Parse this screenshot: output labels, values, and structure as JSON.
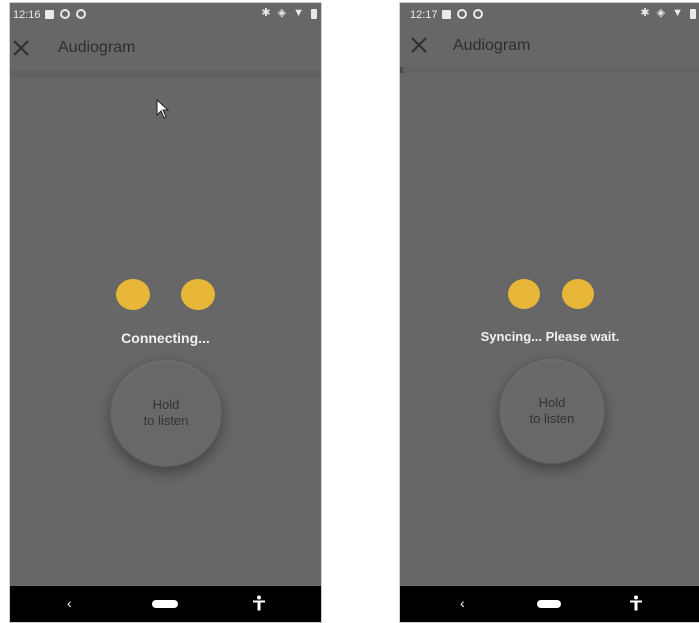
{
  "left": {
    "time": "12:16",
    "app_title": "Audiogram",
    "status_text": "Connecting...",
    "hold_button": {
      "line1": "Hold",
      "line2": "to listen"
    },
    "progress": 0
  },
  "right": {
    "time": "12:17",
    "app_title": "Audiogram",
    "status_text": "Syncing... Please wait.",
    "hold_button": {
      "line1": "Hold",
      "line2": "to listen"
    },
    "progress": 0.01
  },
  "nav": {
    "back": "‹"
  },
  "colors": {
    "background": "#676767",
    "dot": "#e8b638",
    "navbar": "#000000"
  },
  "icons": [
    "close-icon",
    "notification-icon",
    "sync-icon",
    "bluetooth-icon",
    "eye-icon",
    "wifi-icon",
    "battery-icon",
    "back-icon",
    "home-pill-icon",
    "accessibility-icon",
    "mouse-cursor-icon"
  ]
}
